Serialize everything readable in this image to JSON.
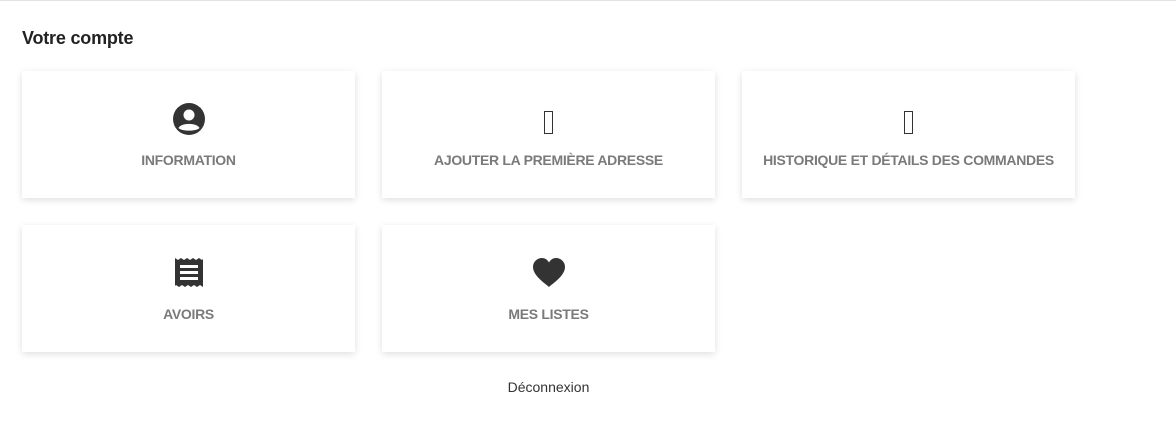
{
  "page": {
    "title": "Votre compte"
  },
  "cards": [
    {
      "label": "INFORMATION",
      "icon": "account-circle-icon"
    },
    {
      "label": "AJOUTER LA PREMIÈRE ADRESSE",
      "icon": "missing-glyph-icon"
    },
    {
      "label": "HISTORIQUE ET DÉTAILS DES COMMANDES",
      "icon": "missing-glyph-icon"
    },
    {
      "label": "AVOIRS",
      "icon": "receipt-icon"
    },
    {
      "label": "MES LISTES",
      "icon": "heart-icon"
    }
  ],
  "footer": {
    "logout_label": "Déconnexion"
  },
  "colors": {
    "icon": "#333333",
    "label": "#7a7a7a",
    "title": "#222222"
  }
}
